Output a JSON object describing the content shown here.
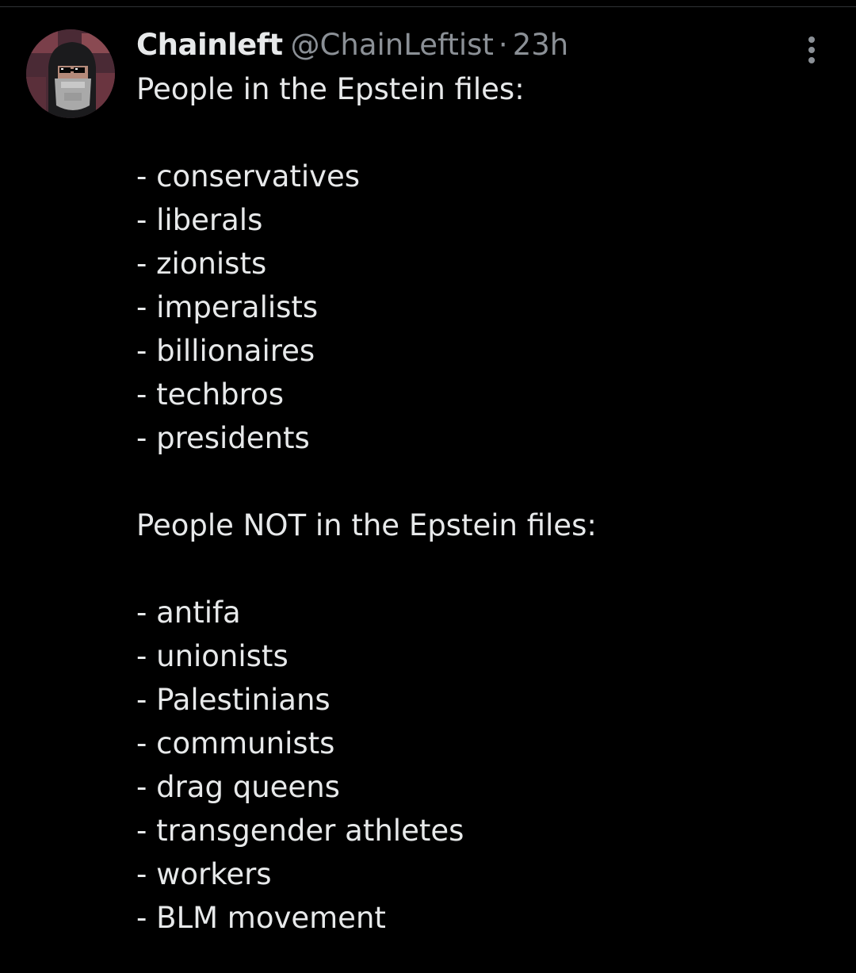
{
  "tweet": {
    "author": {
      "display_name": "Chainleft",
      "handle": "@ChainLeftist"
    },
    "separator": "·",
    "timestamp": "23h",
    "more_icon": "more-vertical-icon",
    "lines": [
      "People in the Epstein files:",
      "",
      "- conservatives",
      "- liberals",
      "- zionists",
      "- imperalists",
      "- billionaires",
      "- techbros",
      "- presidents",
      "",
      "People NOT in the Epstein files:",
      "",
      "- antifa",
      "- unionists",
      "- Palestinians",
      "- communists",
      "- drag queens",
      "- transgender athletes",
      "- workers",
      "- BLM movement"
    ]
  },
  "colors": {
    "background": "#000000",
    "text_primary": "#e7e9ea",
    "text_secondary": "#8b9096",
    "divider": "#2f3336"
  }
}
